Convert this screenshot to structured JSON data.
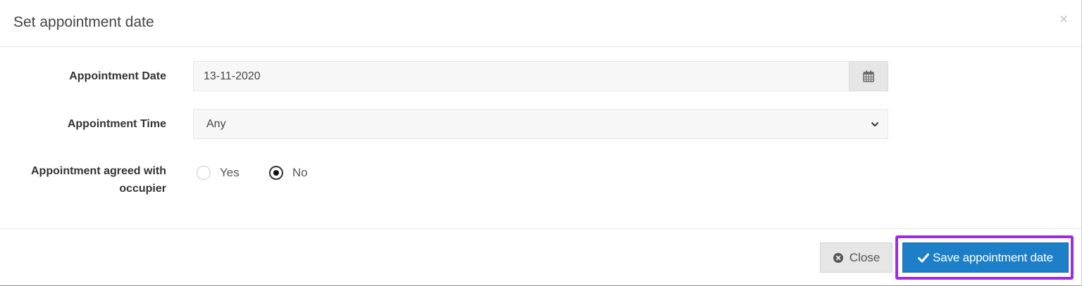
{
  "modal": {
    "title": "Set appointment date",
    "close_glyph": "×"
  },
  "form": {
    "appointment_date": {
      "label": "Appointment Date",
      "value": "13-11-2020",
      "addon_icon": "calendar-icon"
    },
    "appointment_time": {
      "label": "Appointment Time",
      "selected": "Any",
      "chevron_icon": "chevron-down-icon"
    },
    "agreed": {
      "label_line1": "Appointment agreed with",
      "label_line2": "occupier",
      "options": [
        {
          "label": "Yes",
          "checked": false
        },
        {
          "label": "No",
          "checked": true
        }
      ]
    }
  },
  "footer": {
    "close_label": "Close",
    "close_icon": "times-circle-icon",
    "save_label": "Save appointment date",
    "save_icon": "check-icon"
  },
  "colors": {
    "primary": "#1c7fc8",
    "highlight": "#9b2bea",
    "default_button": "#e6e6e6"
  }
}
